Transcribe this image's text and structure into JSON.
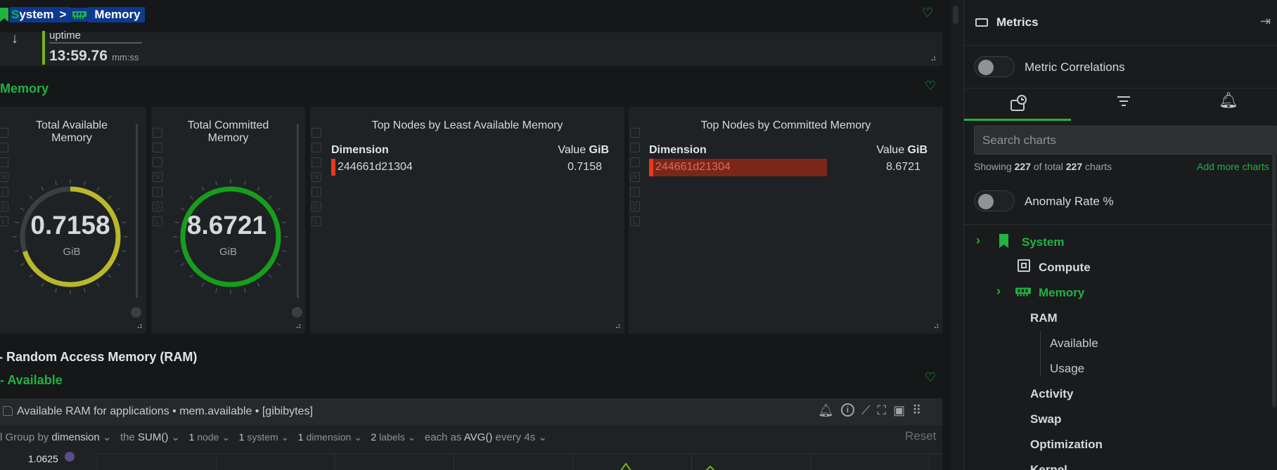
{
  "breadcrumb": {
    "first": "S",
    "first_rest": "ystem",
    "sep": ">",
    "second": "Memory"
  },
  "uptime": {
    "label": "uptime",
    "value": "13:59.76",
    "unit": "mm:ss"
  },
  "memory_section": {
    "title": "Memory"
  },
  "gauge_available": {
    "title_line1": "Total Available",
    "title_line2": "Memory",
    "value": "0.7158",
    "unit": "GiB",
    "fraction": 0.7,
    "color": "#b9b82a"
  },
  "gauge_committed": {
    "title_line1": "Total Committed",
    "title_line2": "Memory",
    "value": "8.6721",
    "unit": "GiB",
    "fraction": 1.0,
    "color": "#159e1c"
  },
  "table_available": {
    "title": "Top Nodes by Least Available Memory",
    "col_dimension": "Dimension",
    "col_value": "Value",
    "col_unit": "GiB",
    "rows": [
      {
        "name": "244661d21304",
        "value": "0.7158"
      }
    ]
  },
  "table_committed": {
    "title": "Top Nodes by Committed Memory",
    "col_dimension": "Dimension",
    "col_value": "Value",
    "col_unit": "GiB",
    "rows": [
      {
        "name": "244661d21304",
        "value": "8.6721"
      }
    ]
  },
  "ram_section": {
    "title": "Random Access Memory (RAM)",
    "sub_title": "- Available"
  },
  "chart": {
    "title": "Available RAM for applications",
    "context": "mem.available",
    "units": "[gibibytes]",
    "y_tick": "1.0625",
    "reset": "Reset",
    "filters": {
      "group_prefix": "Group by",
      "group_value": "dimension",
      "the": "the",
      "agg": "SUM()",
      "nodes_n": "1",
      "nodes": "node",
      "system_n": "1",
      "system": "system",
      "dims_n": "1",
      "dims": "dimension",
      "labels_n": "2",
      "labels": "labels",
      "each_as": "each as",
      "time_agg": "AVG()",
      "every": "every 4s"
    }
  },
  "sidebar": {
    "title": "Metrics",
    "correlations_label": "Metric Correlations",
    "search_placeholder": "Search charts",
    "showing_prefix": "Showing",
    "showing_count": "227",
    "showing_mid": "of total",
    "showing_total": "227",
    "showing_suffix": "charts",
    "add_more": "Add more charts",
    "anomaly_label": "Anomaly Rate %",
    "tree": {
      "system": "System",
      "compute": "Compute",
      "memory": "Memory",
      "ram": "RAM",
      "available": "Available",
      "usage": "Usage",
      "activity": "Activity",
      "swap": "Swap",
      "optimization": "Optimization",
      "kernel": "Kernel"
    }
  },
  "colors": {
    "accent_green": "#1fb343",
    "highlight_red": "#7a2619",
    "bar_red": "#e8391e",
    "uptime_green": "#7ab317"
  }
}
